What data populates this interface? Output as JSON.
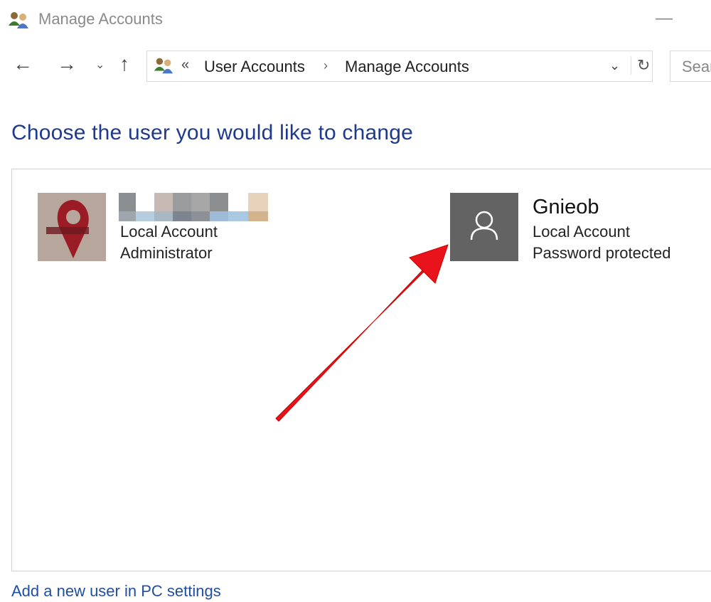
{
  "window": {
    "title": "Manage Accounts",
    "icon": "users-icon",
    "minimize_glyph": "—"
  },
  "nav": {
    "back_glyph": "←",
    "forward_glyph": "→",
    "recent_glyph": "⌄",
    "up_glyph": "↑",
    "address": {
      "overflow_glyph": "«",
      "breadcrumbs": [
        "User Accounts",
        "Manage Accounts"
      ],
      "separator": "›",
      "dropdown_glyph": "⌄",
      "refresh_glyph": "↻"
    },
    "search_placeholder": "Sear"
  },
  "main": {
    "heading": "Choose the user you would like to change",
    "accounts": [
      {
        "name": "",
        "name_redacted": true,
        "type": "Local Account",
        "detail": "Administrator",
        "avatar": "photo-avatar"
      },
      {
        "name": "Gnieob",
        "type": "Local Account",
        "detail": "Password protected",
        "avatar": "default-user-icon"
      }
    ],
    "add_user_link": "Add a new user in PC settings"
  },
  "colors": {
    "heading": "#1e3a8a",
    "link": "#1e4fa0",
    "default_avatar_bg": "#636363",
    "annotation_arrow": "#e8131b"
  }
}
